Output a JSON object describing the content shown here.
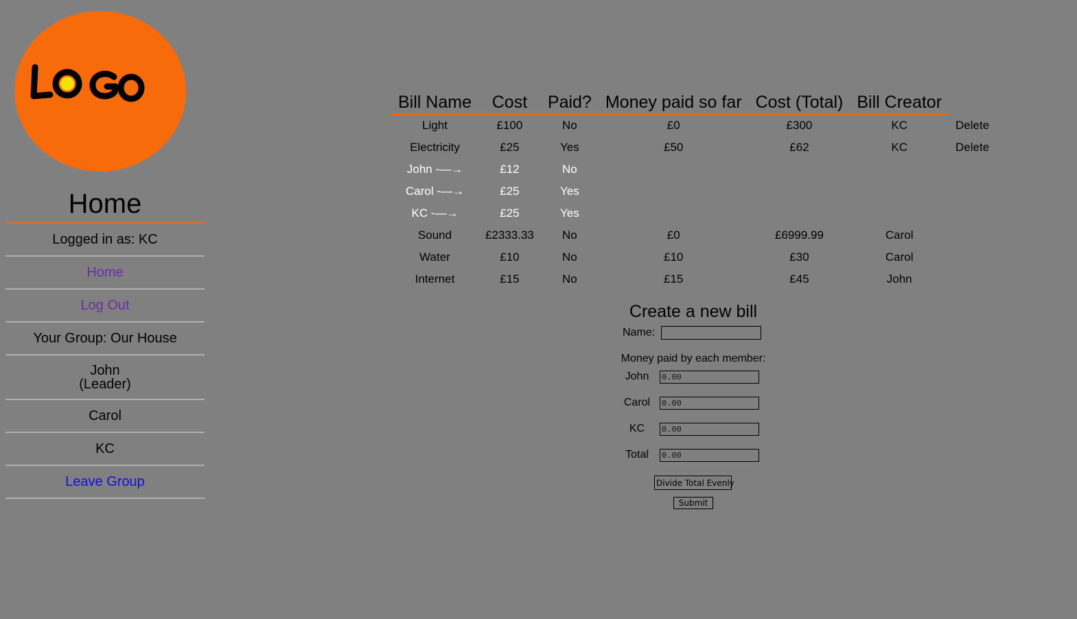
{
  "logo": {
    "text": "LOGO",
    "color": "#f26b0a"
  },
  "sidebar": {
    "title": "Home",
    "logged_in": "Logged in as: KC",
    "home_link": "Home",
    "logout_link": "Log Out",
    "group": "Your Group: Our House",
    "members": [
      {
        "name": "John",
        "note": "(Leader)"
      },
      {
        "name": "Carol"
      },
      {
        "name": "KC"
      }
    ],
    "leave_link": "Leave Group"
  },
  "table": {
    "headers": [
      "Bill Name",
      "Cost",
      "Paid?",
      "Money paid so far",
      "Cost (Total)",
      "Bill Creator"
    ],
    "rows": [
      {
        "name": "Light",
        "cost": "£100",
        "paid": "No",
        "paid_so_far": "£0",
        "total": "£300",
        "creator": "KC",
        "action": "Delete"
      },
      {
        "name": "Electricity",
        "cost": "£25",
        "paid": "Yes",
        "paid_so_far": "£50",
        "total": "£62",
        "creator": "KC",
        "action": "Delete"
      },
      {
        "name": "John -—→",
        "cost": "£12",
        "paid": "No"
      },
      {
        "name": "Carol -—→",
        "cost": "£25",
        "paid": "Yes"
      },
      {
        "name": "KC -—→",
        "cost": "£25",
        "paid": "Yes"
      },
      {
        "name": "Sound",
        "cost": "£2333.33",
        "paid": "No",
        "paid_so_far": "£0",
        "total": "£6999.99",
        "creator": "Carol"
      },
      {
        "name": "Water",
        "cost": "£10",
        "paid": "No",
        "paid_so_far": "£10",
        "total": "£30",
        "creator": "Carol"
      },
      {
        "name": "Internet",
        "cost": "£15",
        "paid": "No",
        "paid_so_far": "£15",
        "total": "£45",
        "creator": "John"
      }
    ]
  },
  "form": {
    "title": "Create a new bill",
    "name_label": "Name:",
    "name_value": "",
    "money_label": "Money paid by each member:",
    "members": [
      {
        "label": "John",
        "value": "0.00"
      },
      {
        "label": "Carol",
        "value": "0.00"
      },
      {
        "label": "KC",
        "value": "0.00"
      },
      {
        "label": "Total",
        "value": "0.00"
      }
    ],
    "divide_button": "Divide Total Evenly",
    "submit_button": "Submit"
  }
}
